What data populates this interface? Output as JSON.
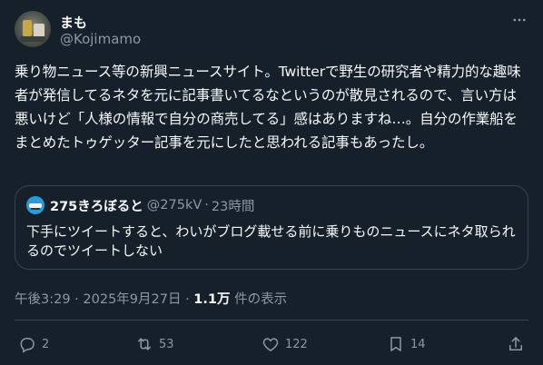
{
  "author": {
    "display_name": "まも",
    "handle": "@Kojimamo"
  },
  "post": {
    "text": "乗り物ニュース等の新興ニュースサイト。Twitterで野生の研究者や精力的な趣味者が発信してるネタを元に記事書いてるなというのが散見されるので、言い方は悪いけど「人様の情報で自分の商売してる」感はありますね…。自分の作業船をまとめたトゥゲッター記事を元にしたと思われる記事もあったし。"
  },
  "quote": {
    "display_name": "275きろぼると",
    "handle": "@275kV",
    "separator": "·",
    "time": "23時間",
    "text": "下手にツイートすると、わいがブログ載せる前に乗りものニュースにネタ取られるのでツイートしない"
  },
  "meta": {
    "timestamp": "午後3:29 · 2025年9月27日 ·",
    "views_count": "1.1万",
    "views_label": "件の表示"
  },
  "actions": {
    "replies": "2",
    "reposts": "53",
    "likes": "122",
    "bookmarks": "14"
  },
  "icons": {
    "more": "more-horizontal-icon",
    "reply": "reply-icon",
    "repost": "repost-icon",
    "like": "heart-icon",
    "bookmark": "bookmark-icon",
    "share": "share-icon"
  },
  "colors": {
    "background": "#15202b",
    "text_primary": "#f7f9f9",
    "text_secondary": "#8b98a5",
    "border": "#38444d"
  }
}
